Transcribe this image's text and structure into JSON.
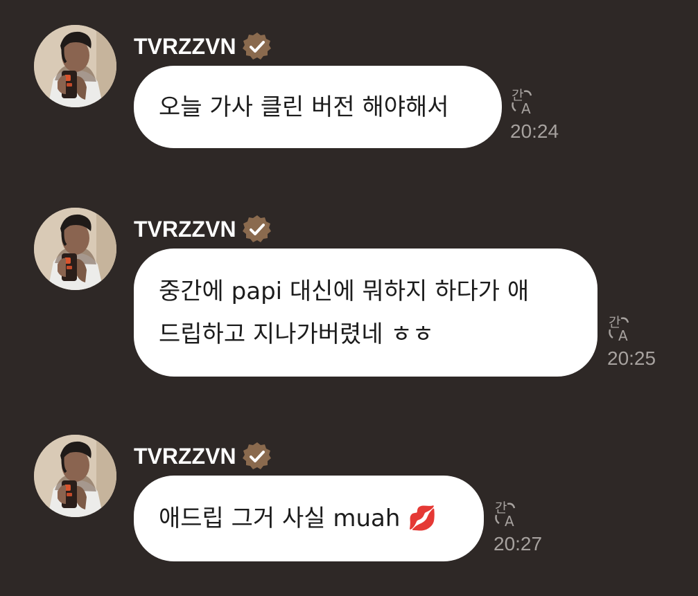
{
  "messages": [
    {
      "sender": "TVRZZVN",
      "text": "오늘 가사 클린 버전 해야해서",
      "time": "20:24",
      "avatar_icon": "profile-photo"
    },
    {
      "sender": "TVRZZVN",
      "text_line1": "중간에 papi 대신에 뭐하지 하다가 애",
      "text_line2": "드립하고 지나가버렸네 ㅎㅎ",
      "time": "20:25",
      "avatar_icon": "profile-photo"
    },
    {
      "sender": "TVRZZVN",
      "text": "애드립 그거 사실 muah 💋",
      "time": "20:27",
      "avatar_icon": "profile-photo"
    }
  ],
  "icons": {
    "verified": "verified-badge-icon",
    "translate": "translate-icon"
  },
  "colors": {
    "background": "#2e2826",
    "bubble": "#ffffff",
    "badge": "#8a6a4e",
    "meta": "#a7a29f"
  }
}
